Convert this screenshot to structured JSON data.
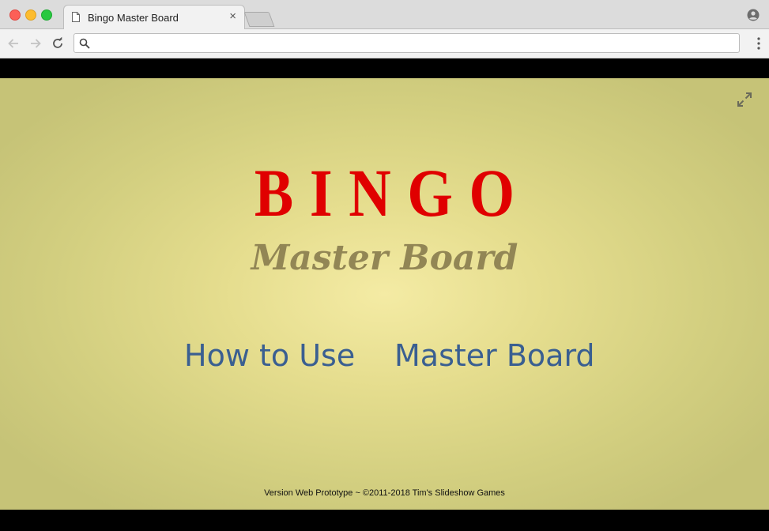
{
  "browser": {
    "tab_title": "Bingo Master Board",
    "tab_close": "×",
    "address_value": "",
    "address_placeholder": ""
  },
  "page": {
    "title": "BINGO",
    "subtitle": "Master Board",
    "links": [
      {
        "label": "How to Use"
      },
      {
        "label": "Master Board"
      }
    ],
    "footer": "Version Web Prototype ~ ©2011-2018 Tim's Slideshow Games"
  },
  "icons": {
    "page": "page-icon",
    "profile": "profile-icon",
    "back": "back-arrow-icon",
    "forward": "forward-arrow-icon",
    "reload": "reload-icon",
    "search": "search-icon",
    "menu": "kebab-menu-icon",
    "fullscreen": "fullscreen-expand-icon"
  },
  "colors": {
    "title": "#e00000",
    "subtitle": "#928655",
    "links": "#3a5f91",
    "background_center": "#f4eba4",
    "background_edge": "#c6c377"
  }
}
